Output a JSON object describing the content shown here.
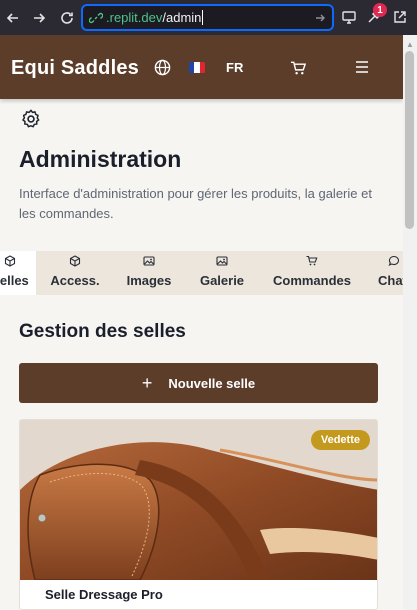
{
  "browser": {
    "url_host": ".replit.dev",
    "url_path": "/admin",
    "notification_count": "1"
  },
  "header": {
    "logo": "Equi Saddles",
    "language": "FR",
    "icons": [
      "globe-icon",
      "french-flag-icon",
      "cart-icon",
      "menu-icon"
    ]
  },
  "main": {
    "title": "Administration",
    "description": "Interface d'administration pour gérer les produits, la galerie et les commandes.",
    "tabs": [
      {
        "label": "Selles",
        "icon": "box-icon",
        "active": true
      },
      {
        "label": "Access.",
        "icon": "box-icon",
        "active": false
      },
      {
        "label": "Images",
        "icon": "image-icon",
        "active": false
      },
      {
        "label": "Galerie",
        "icon": "image-icon",
        "active": false
      },
      {
        "label": "Commandes",
        "icon": "cart-icon",
        "active": false
      },
      {
        "label": "Chat",
        "icon": "chat-icon",
        "active": false
      }
    ],
    "section_title": "Gestion des selles",
    "new_button": "Nouvelle selle",
    "products": [
      {
        "name": "Selle Dressage Pro",
        "badge": "Vedette"
      }
    ]
  },
  "colors": {
    "brand_brown": "#5c3d2a",
    "tab_bar": "#ece6dc",
    "featured_gold": "#c49a1e",
    "url_focus": "#0f69ff"
  }
}
